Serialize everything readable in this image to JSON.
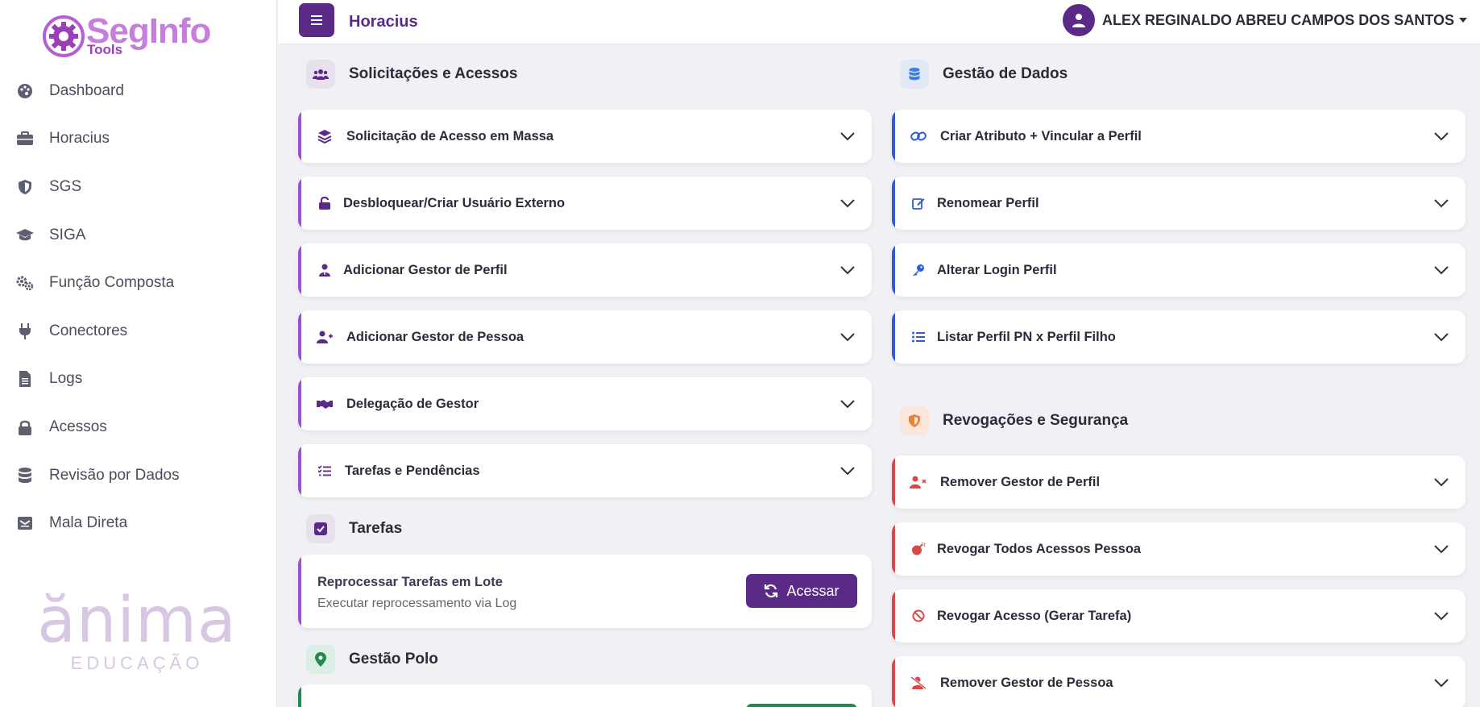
{
  "app": {
    "logo_text": "SegInfo",
    "logo_sub": "Tools",
    "brand_main": "ănima",
    "brand_sub": "EDUCAÇÃO"
  },
  "sidebar": {
    "items": [
      {
        "label": "Dashboard",
        "icon": "palette-icon"
      },
      {
        "label": "Horacius",
        "icon": "briefcase-icon"
      },
      {
        "label": "SGS",
        "icon": "shield-icon"
      },
      {
        "label": "SIGA",
        "icon": "graduation-cap-icon"
      },
      {
        "label": "Função Composta",
        "icon": "gears-icon"
      },
      {
        "label": "Conectores",
        "icon": "plug-icon"
      },
      {
        "label": "Logs",
        "icon": "file-icon"
      },
      {
        "label": "Acessos",
        "icon": "lock-icon"
      },
      {
        "label": "Revisão por Dados",
        "icon": "database-icon"
      },
      {
        "label": "Mala Direta",
        "icon": "mail-icon"
      }
    ]
  },
  "header": {
    "title": "Horacius",
    "user_name": "ALEX REGINALDO ABREU CAMPOS DOS SANTOS"
  },
  "colors": {
    "primary": "#5b2a86",
    "purple_accent": "#9b4fd1",
    "blue_accent": "#2f5bd6",
    "red_accent": "#d94848",
    "green_accent": "#1f8a4c"
  },
  "left": {
    "section1": {
      "title": "Solicitações e Acessos",
      "items": [
        {
          "label": "Solicitação de Acesso em Massa",
          "icon": "layers-icon"
        },
        {
          "label": "Desbloquear/Criar Usuário Externo",
          "icon": "unlock-icon"
        },
        {
          "label": "Adicionar Gestor de Perfil",
          "icon": "user-tie-icon"
        },
        {
          "label": "Adicionar Gestor de Pessoa",
          "icon": "user-plus-icon"
        },
        {
          "label": "Delegação de Gestor",
          "icon": "handshake-icon"
        },
        {
          "label": "Tarefas e Pendências",
          "icon": "list-check-icon"
        }
      ]
    },
    "section2": {
      "title": "Tarefas",
      "task": {
        "title": "Reprocessar Tarefas em Lote",
        "subtitle": "Executar reprocessamento via Log",
        "button": "Acessar"
      }
    },
    "section3": {
      "title": "Gestão Polo"
    }
  },
  "right": {
    "section1": {
      "title": "Gestão de Dados",
      "items": [
        {
          "label": "Criar Atributo + Vincular a Perfil",
          "icon": "link-icon"
        },
        {
          "label": "Renomear Perfil",
          "icon": "edit-icon"
        },
        {
          "label": "Alterar Login Perfil",
          "icon": "key-icon"
        },
        {
          "label": "Listar Perfil PN x Perfil Filho",
          "icon": "list-icon"
        }
      ]
    },
    "section2": {
      "title": "Revogações e Segurança",
      "items": [
        {
          "label": "Remover Gestor de Perfil",
          "icon": "user-x-icon"
        },
        {
          "label": "Revogar Todos Acessos Pessoa",
          "icon": "bomb-icon"
        },
        {
          "label": "Revogar Acesso (Gerar Tarefa)",
          "icon": "ban-icon"
        },
        {
          "label": "Remover Gestor de Pessoa",
          "icon": "user-slash-icon"
        }
      ]
    }
  }
}
